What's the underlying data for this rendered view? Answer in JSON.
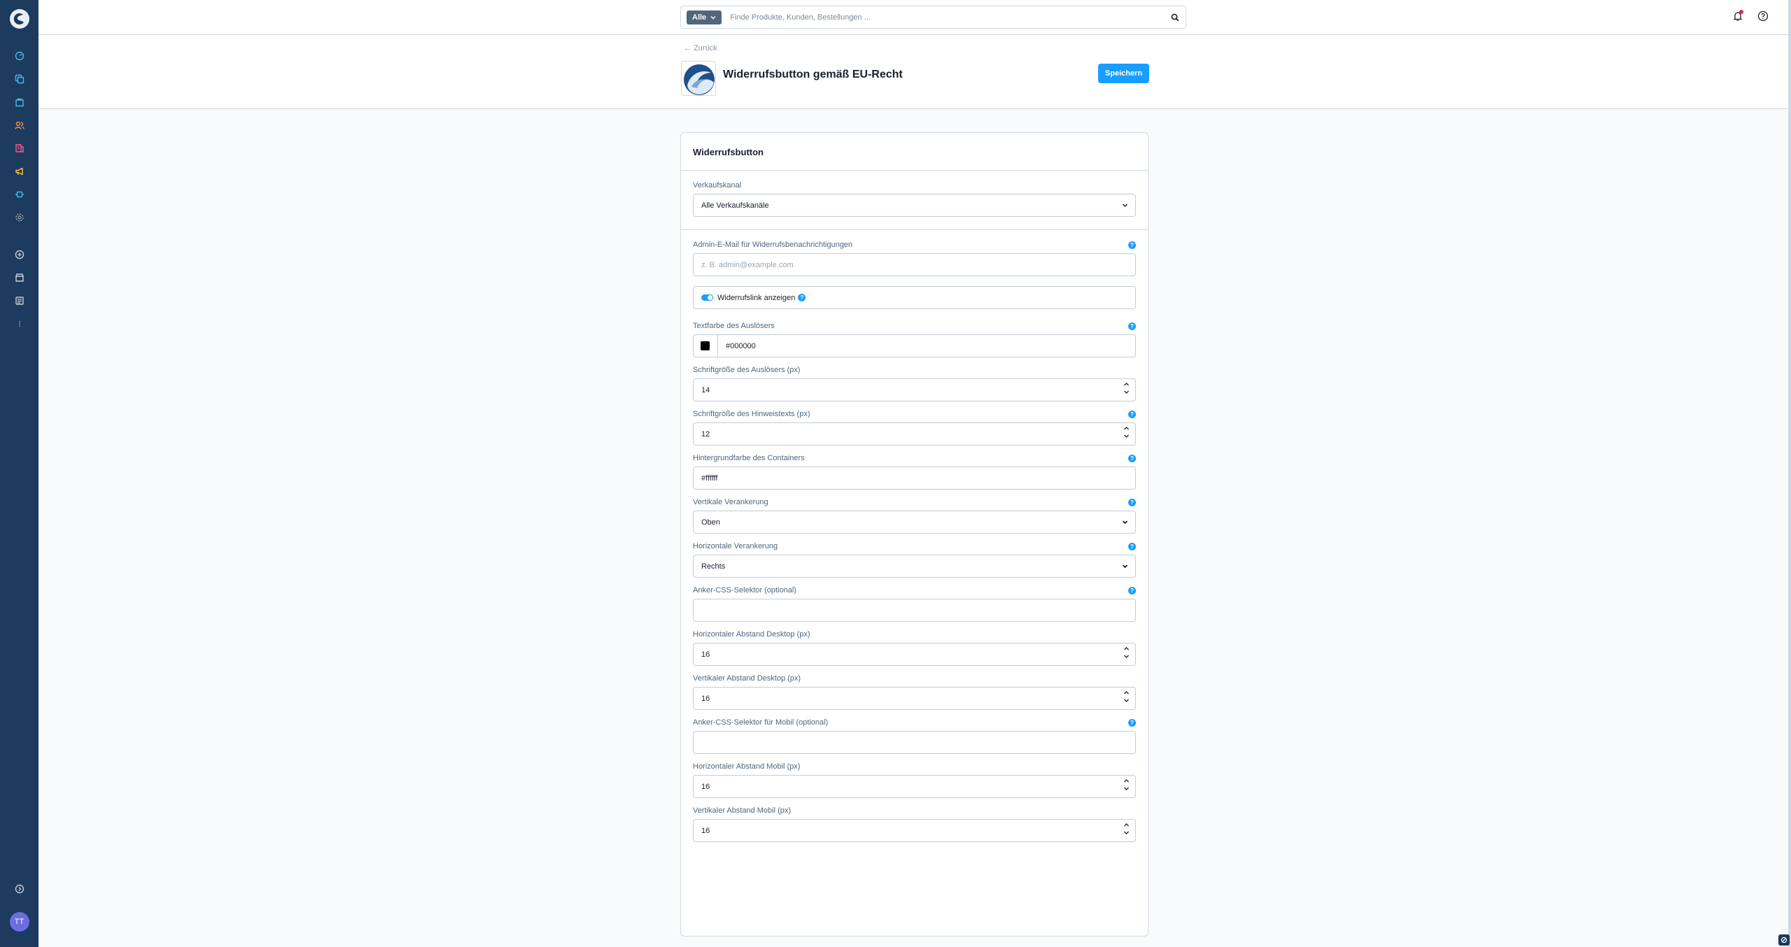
{
  "topbar": {
    "search_type": "Alle",
    "search_placeholder": "Finde Produkte, Kunden, Bestellungen ..."
  },
  "header": {
    "back_label": "Zurück",
    "title": "Widerrufsbutton gemäß EU-Recht",
    "save_label": "Speichern"
  },
  "sidebar": {
    "avatar_initials": "TT",
    "items": [
      {
        "name": "dashboard",
        "color": "#3ec1e6"
      },
      {
        "name": "catalogues",
        "color": "#3ec1e6"
      },
      {
        "name": "orders",
        "color": "#3ec1e6"
      },
      {
        "name": "customers",
        "color": "#ff8d46"
      },
      {
        "name": "content",
        "color": "#ff5b92"
      },
      {
        "name": "marketing",
        "color": "#ffc23b"
      },
      {
        "name": "extensions",
        "color": "#3ec1e6"
      },
      {
        "name": "settings",
        "color": "#8a99a8"
      }
    ]
  },
  "card": {
    "title": "Widerrufsbutton",
    "sales_channel": {
      "label": "Verkaufskanal",
      "value": "Alle Verkaufskanäle"
    },
    "admin_email": {
      "label": "Admin-E-Mail für Widerrufsbenachrichtigungen",
      "placeholder": "z. B. admin@example.com"
    },
    "show_link": {
      "label": "Widerrufslink anzeigen",
      "enabled": true
    },
    "trigger_color": {
      "label": "Textfarbe des Auslösers",
      "value": "#000000"
    },
    "trigger_font_size": {
      "label": "Schriftgröße des Auslösers (px)",
      "value": "14"
    },
    "hint_font_size": {
      "label": "Schriftgröße des Hinweistexts (px)",
      "value": "12"
    },
    "container_bg": {
      "label": "Hintergrundfarbe des Containers",
      "value": "#ffffff"
    },
    "vertical_anchor": {
      "label": "Vertikale Verankerung",
      "value": "Oben"
    },
    "horizontal_anchor": {
      "label": "Horizontale Verankerung",
      "value": "Rechts"
    },
    "anchor_selector": {
      "label": "Anker-CSS-Selektor (optional)",
      "value": ""
    },
    "h_offset_desktop": {
      "label": "Horizontaler Abstand Desktop (px)",
      "value": "16"
    },
    "v_offset_desktop": {
      "label": "Vertikaler Abstand Desktop (px)",
      "value": "16"
    },
    "anchor_selector_mobile": {
      "label": "Anker-CSS-Selektor für Mobil (optional)",
      "value": ""
    },
    "h_offset_mobile": {
      "label": "Horizontaler Abstand Mobil (px)",
      "value": "16"
    },
    "v_offset_mobile": {
      "label": "Vertikaler Abstand Mobil (px)",
      "value": "16"
    }
  },
  "colors": {
    "sidebar_bg": "#1d3a5f",
    "primary": "#189eff",
    "notification_dot": "#e3264b"
  }
}
